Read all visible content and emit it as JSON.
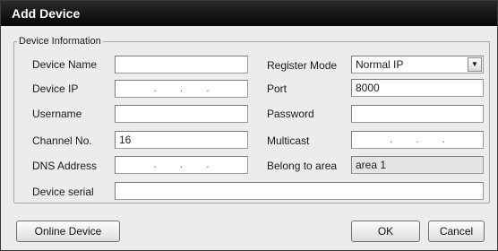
{
  "dialog": {
    "title": "Add Device"
  },
  "group": {
    "legend": "Device Information"
  },
  "fields": {
    "device_name": {
      "label": "Device Name",
      "value": ""
    },
    "register_mode": {
      "label": "Register Mode",
      "value": "Normal IP"
    },
    "device_ip": {
      "label": "Device IP",
      "octets": [
        ".",
        ".",
        "."
      ]
    },
    "port": {
      "label": "Port",
      "value": "8000"
    },
    "username": {
      "label": "Username",
      "value": ""
    },
    "password": {
      "label": "Password",
      "value": ""
    },
    "channel_no": {
      "label": "Channel No.",
      "value": "16"
    },
    "multicast": {
      "label": "Multicast",
      "octets": [
        ".",
        ".",
        "."
      ]
    },
    "dns_address": {
      "label": "DNS Address",
      "octets": [
        ".",
        ".",
        "."
      ]
    },
    "belong_to_area": {
      "label": "Belong to area",
      "value": "area 1"
    },
    "device_serial": {
      "label": "Device serial",
      "value": ""
    }
  },
  "buttons": {
    "online_device": "Online Device",
    "ok": "OK",
    "cancel": "Cancel"
  },
  "icons": {
    "dropdown": "chevron-down-icon"
  }
}
